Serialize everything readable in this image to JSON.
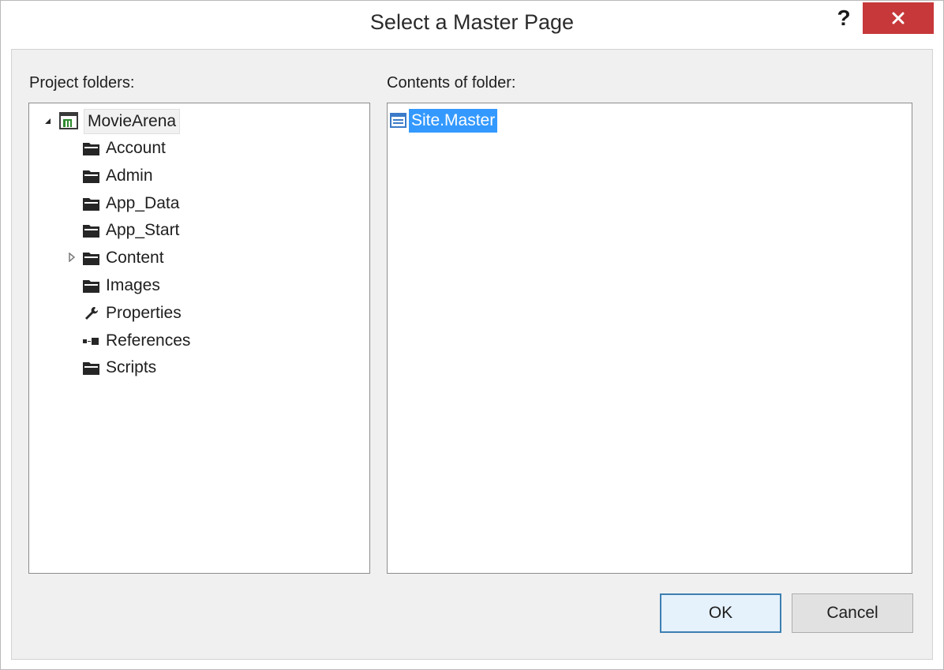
{
  "dialog": {
    "title": "Select a Master Page",
    "help_label": "?"
  },
  "project_folders": {
    "label": "Project folders:",
    "root": {
      "label": "MovieArena",
      "expanded": true
    },
    "items": [
      {
        "label": "Account",
        "icon": "folder-icon",
        "has_children": false
      },
      {
        "label": "Admin",
        "icon": "folder-icon",
        "has_children": false
      },
      {
        "label": "App_Data",
        "icon": "folder-icon",
        "has_children": false
      },
      {
        "label": "App_Start",
        "icon": "folder-icon",
        "has_children": false
      },
      {
        "label": "Content",
        "icon": "folder-icon",
        "has_children": true
      },
      {
        "label": "Images",
        "icon": "folder-icon",
        "has_children": false
      },
      {
        "label": "Properties",
        "icon": "wrench-icon",
        "has_children": false
      },
      {
        "label": "References",
        "icon": "references-icon",
        "has_children": false
      },
      {
        "label": "Scripts",
        "icon": "folder-icon",
        "has_children": false
      }
    ]
  },
  "contents": {
    "label": "Contents of folder:",
    "items": [
      {
        "label": "Site.Master",
        "icon": "master-page-icon",
        "selected": true
      }
    ]
  },
  "buttons": {
    "ok": "OK",
    "cancel": "Cancel"
  },
  "colors": {
    "close_button": "#c7383b",
    "selection": "#3399ff",
    "default_button_border": "#3c7fb1"
  }
}
